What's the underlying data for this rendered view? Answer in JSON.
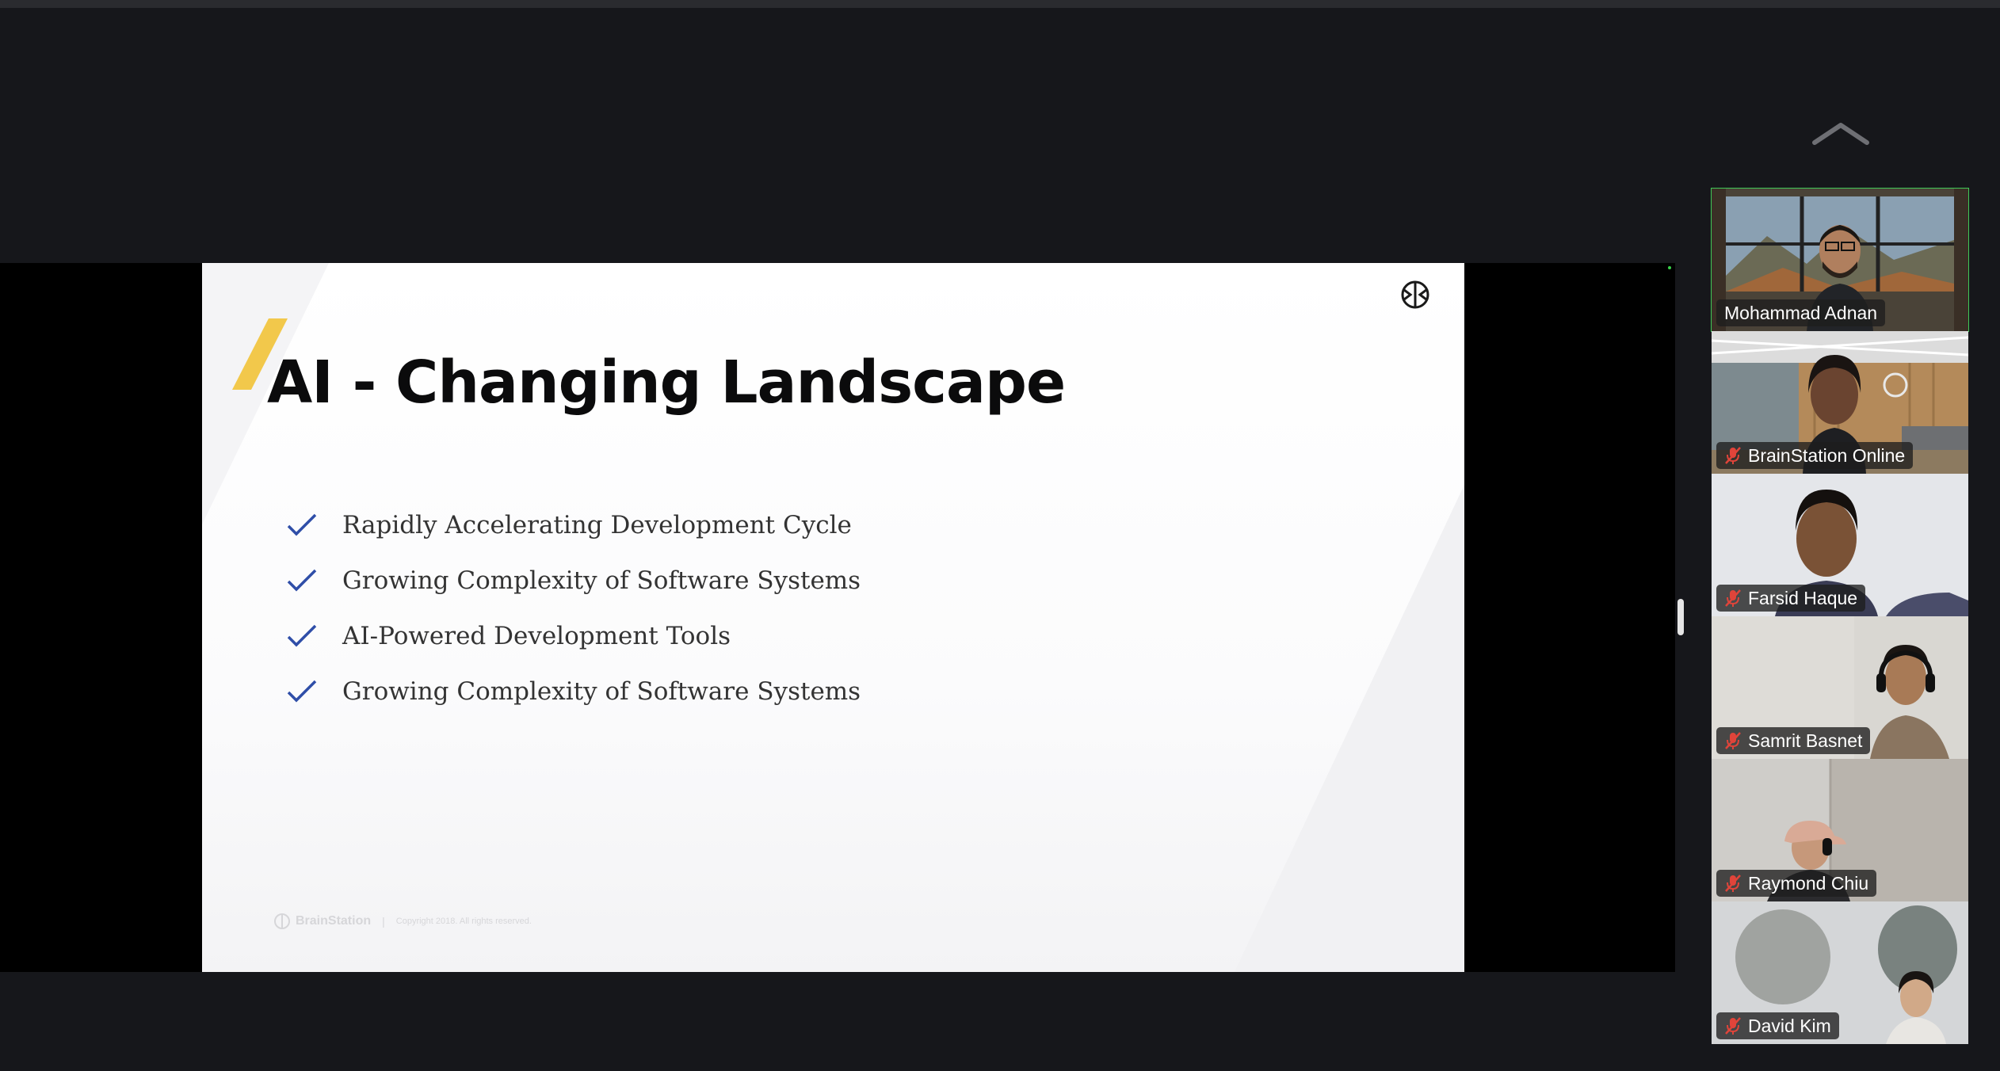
{
  "slide": {
    "title": "AI - Changing Landscape",
    "bullets": [
      "Rapidly Accelerating Development Cycle",
      "Growing Complexity of Software Systems",
      "AI-Powered Development Tools",
      "Growing Complexity of Software Systems"
    ],
    "footer_brand": "BrainStation",
    "footer_separator": "|",
    "footer_copyright": "Copyright 2018. All rights reserved.",
    "accent_color": "#f2c84b",
    "check_color": "#2f4ea8"
  },
  "participants": [
    {
      "name": "Mohammad Adnan",
      "muted": false,
      "active_speaker": true
    },
    {
      "name": "BrainStation Online",
      "muted": true,
      "active_speaker": false
    },
    {
      "name": "Farsid Haque",
      "muted": true,
      "active_speaker": false
    },
    {
      "name": "Samrit Basnet",
      "muted": true,
      "active_speaker": false
    },
    {
      "name": "Raymond Chiu",
      "muted": true,
      "active_speaker": false
    },
    {
      "name": "David Kim",
      "muted": true,
      "active_speaker": false
    }
  ],
  "icons": {
    "collapse": "chevron-up-icon",
    "mute": "mic-muted-icon",
    "brand": "brain-logo-icon",
    "check": "check-icon"
  },
  "colors": {
    "active_speaker_border": "#40c957",
    "muted_icon": "#e0443a",
    "background": "#16171b"
  }
}
